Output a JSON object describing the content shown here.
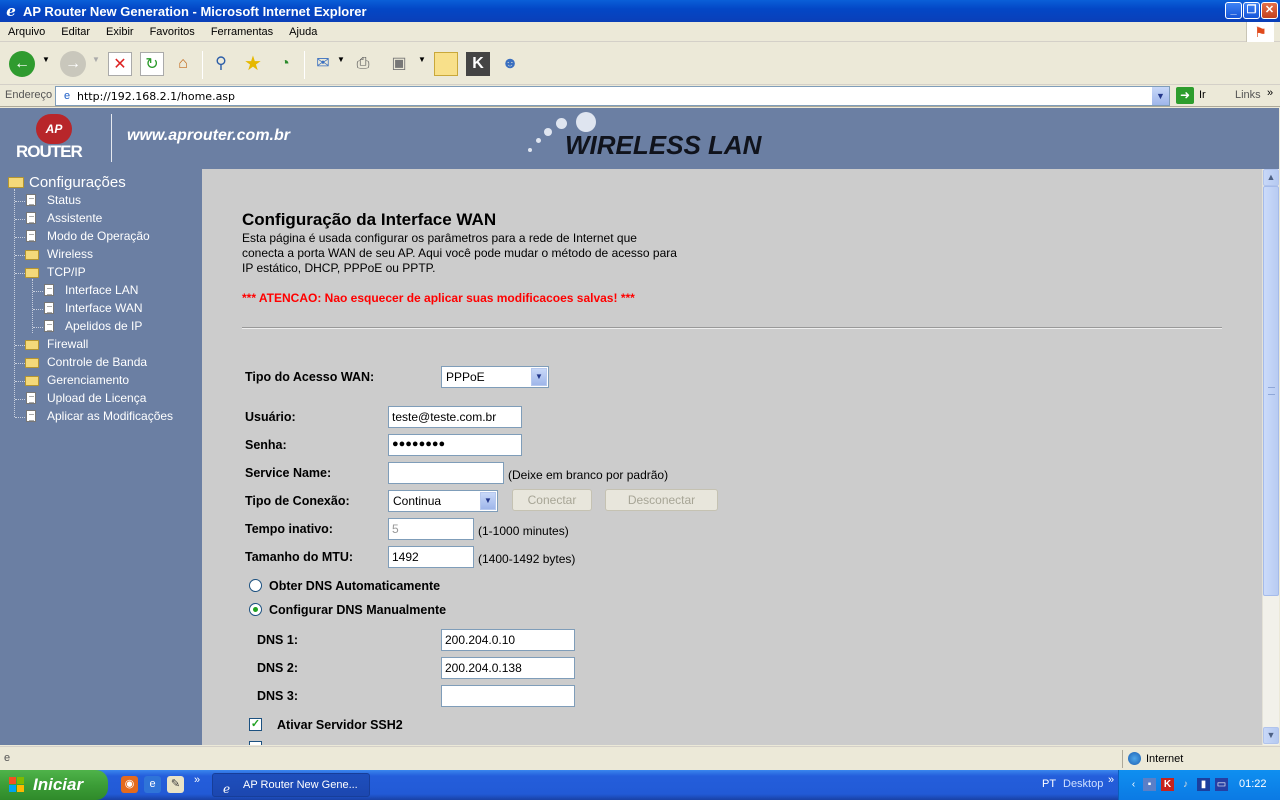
{
  "window": {
    "title": "AP Router New Generation - Microsoft Internet Explorer"
  },
  "menu": [
    "Arquivo",
    "Editar",
    "Exibir",
    "Favoritos",
    "Ferramentas",
    "Ajuda"
  ],
  "address": {
    "label": "Endereço",
    "url": "http://192.168.2.1/home.asp",
    "go": "Ir",
    "links": "Links"
  },
  "banner": {
    "logo_top": "AP",
    "logo_bottom": "ROUTER",
    "site": "www.aprouter.com.br",
    "product": "WIRELESS LAN"
  },
  "sidebar": {
    "root": "Configurações",
    "items": {
      "status": "Status",
      "assistente": "Assistente",
      "modo": "Modo de Operação",
      "wireless": "Wireless",
      "tcpip": "TCP/IP",
      "lan": "Interface LAN",
      "wan": "Interface WAN",
      "apelidos": "Apelidos de IP",
      "firewall": "Firewall",
      "banda": "Controle de Banda",
      "gerenciamento": "Gerenciamento",
      "licenca": "Upload de Licença",
      "aplicar": "Aplicar as Modificações"
    }
  },
  "content": {
    "title": "Configuração da Interface WAN",
    "description": "Esta página é usada configurar os parâmetros para a rede de Internet que conecta a porta WAN de seu AP. Aqui você pode mudar o método de acesso para IP estático, DHCP, PPPoE ou PPTP.",
    "warning": "*** ATENCAO: Nao esquecer de aplicar suas modificacoes salvas! ***",
    "wan_type": {
      "label": "Tipo do Acesso WAN:",
      "value": "PPPoE"
    },
    "user": {
      "label": "Usuário:",
      "value": "teste@teste.com.br"
    },
    "password": {
      "label": "Senha:",
      "value": "●●●●●●●●"
    },
    "service": {
      "label": "Service Name:",
      "value": "",
      "note": "(Deixe em branco por padrão)"
    },
    "conn_type": {
      "label": "Tipo de Conexão:",
      "value": "Continua",
      "connect": "Conectar",
      "disconnect": "Desconectar"
    },
    "idle": {
      "label": "Tempo inativo:",
      "value": "5",
      "note": "(1-1000 minutes)"
    },
    "mtu": {
      "label": "Tamanho do MTU:",
      "value": "1492",
      "note": "(1400-1492 bytes)"
    },
    "dns_auto": {
      "label": "Obter DNS Automaticamente",
      "selected": false
    },
    "dns_manual": {
      "label": "Configurar DNS Manualmente",
      "selected": true
    },
    "dns1": {
      "label": "DNS 1:",
      "value": "200.204.0.10"
    },
    "dns2": {
      "label": "DNS 2:",
      "value": "200.204.0.138"
    },
    "dns3": {
      "label": "DNS 3:",
      "value": ""
    },
    "ssh": {
      "label": "Ativar Servidor SSH2",
      "checked": true
    }
  },
  "status": {
    "zone": "Internet"
  },
  "taskbar": {
    "start": "Iniciar",
    "task": "AP Router New Gene...",
    "lang": "PT",
    "desktop": "Desktop",
    "clock": "01:22"
  }
}
